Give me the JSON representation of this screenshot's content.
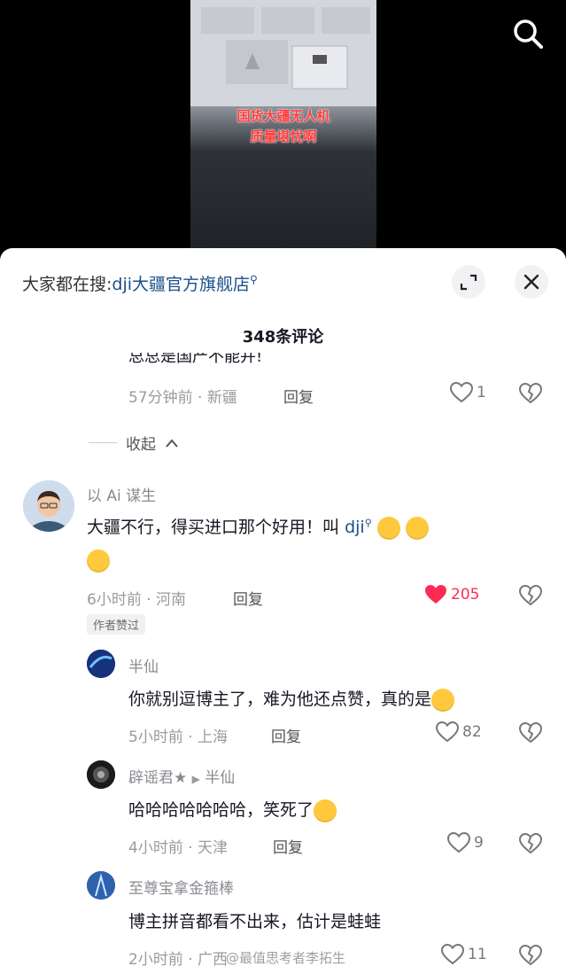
{
  "video": {
    "overlay_line1": "国货大疆无人机",
    "overlay_line2": "质量堪忧啊"
  },
  "sheet": {
    "hot_search_prefix": "大家都在搜:",
    "hot_search_link": "dji大疆官方旗舰店",
    "comment_count": "348条评论",
    "collapse_label": "收起"
  },
  "top_reply": {
    "cut_text": "总总是国产不能并!",
    "time_location": "57分钟前 · 新疆",
    "reply_label": "回复",
    "likes": "1"
  },
  "comments": [
    {
      "username": "以 Ai 谋生",
      "text": "大疆不行，得买进口那个好用！叫",
      "mention": "dji",
      "time_location": "6小时前 · 河南",
      "reply_label": "回复",
      "likes": "205",
      "badge": "作者赞过"
    },
    {
      "username": "半仙",
      "text": "你就别逗博主了，难为他还点赞，真的是",
      "time_location": "5小时前 · 上海",
      "reply_label": "回复",
      "likes": "82"
    },
    {
      "username": "辟谣君★",
      "reply_to": "半仙",
      "text": "哈哈哈哈哈哈哈，笑死了",
      "time_location": "4小时前 · 天津",
      "reply_label": "回复",
      "likes": "9"
    },
    {
      "username": "至尊宝拿金箍棒",
      "text": "博主拼音都看不出来，估计是蛙蛙",
      "time_location": "2小时前 · 广西",
      "reply_label": "回复",
      "likes": "11"
    }
  ],
  "watermark": "@最值思考者李拓生",
  "colors": {
    "like_red": "#fe2c55",
    "link_blue": "#1a4f8a"
  },
  "icons": [
    "search-icon",
    "expand-icon",
    "close-icon",
    "heart-icon",
    "broken-heart-icon",
    "chevron-up-icon"
  ]
}
